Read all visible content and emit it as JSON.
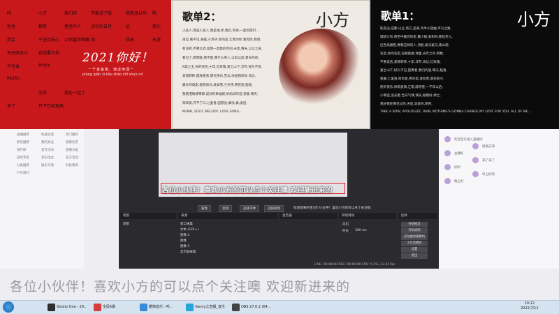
{
  "red_panel": {
    "title": "2021你好！",
    "subtitle": "一千金备箱、谦虚用遇一",
    "pinyin": "piāng qiān zì kǒu   zhào zhǐ shuò mǐ",
    "items": [
      "吗",
      "小方",
      "我们的",
      "不能说了我",
      "陈奕迅以鸟",
      "陶",
      "你也",
      "都等",
      "星座坏人",
      "点中的日月",
      "远",
      "我乐",
      "我会",
      "不坚持安心",
      "以你嘉宾喝嘛",
      "四",
      "我来",
      "天涯",
      "天天面对小",
      "我想要为你",
      "FLOW",
      "",
      "",
      "远去你的",
      "与也会",
      "Angle",
      "",
      "陈我",
      "以你不放不",
      "不爱得平的话",
      "Mojito",
      "",
      "认为",
      "我们的回忆",
      "我不爱你的我",
      "Don't stop",
      "",
      "空白",
      "我在一起了",
      "",
      "",
      "",
      "多了",
      "只下已经现高"
    ]
  },
  "paper_panel": {
    "title": "歌单2：",
    "brand": "小方",
    "lines": [
      "小美人,我是小美人,我是谁,你,我们,有你,一起的旅行...",
      "再见,看不见,陪着,小苏子,你的美,让我为你,我和你,我想,",
      "有没有,不算太迟,给我一首歌的时间,天黑,晴天,以父之名,",
      "看见了,明明就,我不配,算什么男人,以前以后,夏天的风,",
      "K歌之王,你的背包,十年,红玫瑰,富士山下,浮夸,好久不见,",
      "爱情转移,孤独患者,阴天快乐,苦瓜,你给我听好,淘汰,",
      "最长的电影,烟花易冷,发如雪,兰亭序,青花瓷,稻香,",
      "我落泪情绪零碎,说好的幸福呢,听妈妈的话,安静,晴天,",
      "简单爱,开不了口,七里香,园游会,搁浅,枫,退后,",
      "NUMB, SOLO, MELODY, LOVE SONG..."
    ]
  },
  "black_panel": {
    "title": "歌单1：",
    "brand": "小方",
    "lines": [
      "陈奕迅,成都,山丘,南方,后来,月半小夜曲,平凡之路,",
      "理想三旬,夜空中最亮的星,董小姐,安和桥,那些花儿,",
      "红色高跟鞋,像我这样的人,消愁,斑马斑马,南山南,",
      "答案,你的答案,说散就散,体面,光年之外,倒数,",
      "不要说话,爱情转移,十年,浮夸,淘汰,红玫瑰,",
      "富士山下,好久不见,孤勇者,我们的爱,晴天,稻香,",
      "夜曲,七里香,简单爱,青花瓷,发如雪,烟花易冷,",
      "阴天快乐,修炼爱情,江南,醉赤壁,一千年以后,",
      "小幸运,追光者,告白气球,演员,刚刚好,绅士,",
      "我好像在哪见过你,天后,说爱你,倒带,",
      "TAKE A BOW, APOLOGIZE, RAIN, NOTHING'S GONNA CHANGE MY LOVE FOR YOU, ALL OF ME..."
    ]
  },
  "left_panel": {
    "items": [
      "主播推荐",
      "快速说话",
      "热门推荐",
      "新近推荐",
      "我的关注",
      "观看历史",
      "排行榜",
      "官方活动",
      "直播分类",
      "游戏专区",
      "音乐电台",
      "官方活动",
      "分类推荐",
      "娱乐天地",
      "科技教育",
      "户外旅行"
    ]
  },
  "obs": {
    "marquee": "各位小伙伴！喜欢小方的可以点个关注噢 欢迎新进来的",
    "toolbar": [
      "属性",
      "滤镜",
      "选择字体",
      "选择颜色"
    ],
    "toolbar_text": "欢迎新来的宝贝们小伙伴！喜欢小方的可以点个关注噢",
    "docks": [
      "场景",
      "来源",
      "混音器",
      "转场特效",
      "控件"
    ],
    "scenes": [
      "场景"
    ],
    "sources": [
      "窗口采集",
      "文本 (GDI+)",
      "图像 2",
      "图像",
      "图像 3",
      "显示器采集"
    ],
    "transition": {
      "label": "淡出",
      "duration_label": "时长",
      "duration": "300 ms"
    },
    "controls": [
      "开始推流",
      "开始录制",
      "启动虚拟摄像机",
      "工作室模式",
      "设置",
      "退出"
    ],
    "status": "LIVE: 00:00:00   REC: 00:00:00   CPU: 5.2%, 23.61 fps"
  },
  "chat": {
    "lines": [
      "欢迎宝贝进入直播间",
      "感谢支持",
      "主播好",
      "来了来了",
      "好听",
      "早上好呀",
      "晚上好"
    ]
  },
  "big_marquee": "各位小伙伴！喜欢小方的可以点个关注噢 欢迎新进来的",
  "taskbar": {
    "items": [
      "Studio One - 20..",
      "全民K歌",
      "酷狗音乐 - 听..",
      "Vanny之直播_音乐",
      "OBS 27.0.1 (64..."
    ],
    "time": "20:12",
    "date": "2022/7/12"
  }
}
